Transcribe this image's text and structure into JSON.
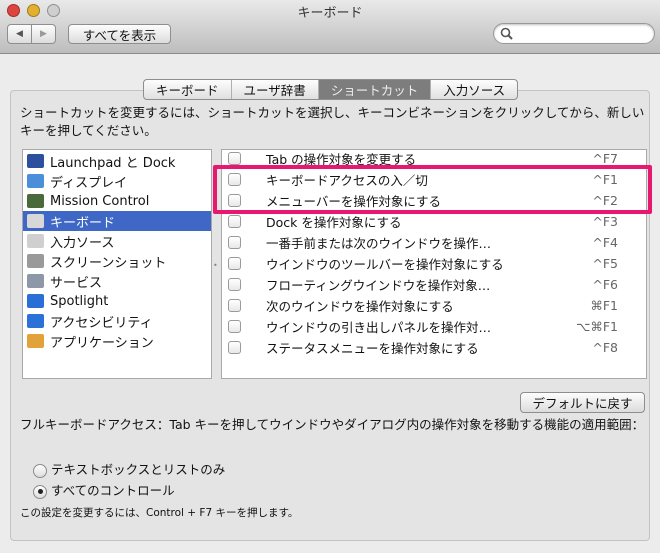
{
  "window": {
    "title": "キーボード"
  },
  "toolbar": {
    "back_icon": "◀",
    "forward_icon": "▶",
    "show_all": "すべてを表示",
    "search_placeholder": ""
  },
  "tabs": [
    {
      "label": "キーボード"
    },
    {
      "label": "ユーザ辞書"
    },
    {
      "label": "ショートカット",
      "selected": true
    },
    {
      "label": "入力ソース"
    }
  ],
  "description": "ショートカットを変更するには、ショートカットを選択し、キーコンビネーションをクリックしてから、新しいキーを押してください。",
  "categories": [
    {
      "label": "Launchpad と Dock",
      "icon": "launchpad-icon",
      "color": "#2c4f9e"
    },
    {
      "label": "ディスプレイ",
      "icon": "display-icon",
      "color": "#4a8fd8"
    },
    {
      "label": "Mission Control",
      "icon": "mission-control-icon",
      "color": "#4b6a3a"
    },
    {
      "label": "キーボード",
      "icon": "keyboard-icon",
      "color": "#d8d8d8",
      "selected": true
    },
    {
      "label": "入力ソース",
      "icon": "keyboard-icon",
      "color": "#cfcfcf"
    },
    {
      "label": "スクリーンショット",
      "icon": "screenshot-icon",
      "color": "#9a9a9a"
    },
    {
      "label": "サービス",
      "icon": "gear-icon",
      "color": "#8c97a8"
    },
    {
      "label": "Spotlight",
      "icon": "spotlight-icon",
      "color": "#2a6fd6"
    },
    {
      "label": "アクセシビリティ",
      "icon": "accessibility-icon",
      "color": "#2a72d8"
    },
    {
      "label": "アプリケーション",
      "icon": "applications-icon",
      "color": "#e2a23a"
    }
  ],
  "shortcuts": [
    {
      "label": "Tab の操作対象を変更する",
      "key": "^F7"
    },
    {
      "label": "キーボードアクセスの入／切",
      "key": "^F1"
    },
    {
      "label": "メニューバーを操作対象にする",
      "key": "^F2"
    },
    {
      "label": "Dock を操作対象にする",
      "key": "^F3"
    },
    {
      "label": "一番手前または次のウインドウを操作…",
      "key": "^F4"
    },
    {
      "label": "ウインドウのツールバーを操作対象にする",
      "key": "^F5"
    },
    {
      "label": "フローティングウインドウを操作対象…",
      "key": "^F6"
    },
    {
      "label": "次のウインドウを操作対象にする",
      "key": "⌘F1"
    },
    {
      "label": "ウインドウの引き出しパネルを操作対…",
      "key": "⌥⌘F1"
    },
    {
      "label": "ステータスメニューを操作対象にする",
      "key": "^F8"
    }
  ],
  "default_button": "デフォルトに戻す",
  "full_access_text": "フルキーボードアクセス：Tab キーを押してウインドウやダイアログ内の操作対象を移動する機能の適用範囲：",
  "radios": [
    {
      "label": "テキストボックスとリストのみ",
      "checked": false
    },
    {
      "label": "すべてのコントロール",
      "checked": true
    }
  ],
  "footnote": "この設定を変更するには、Control + F7 キーを押します。",
  "highlight_color": "#e8176f"
}
